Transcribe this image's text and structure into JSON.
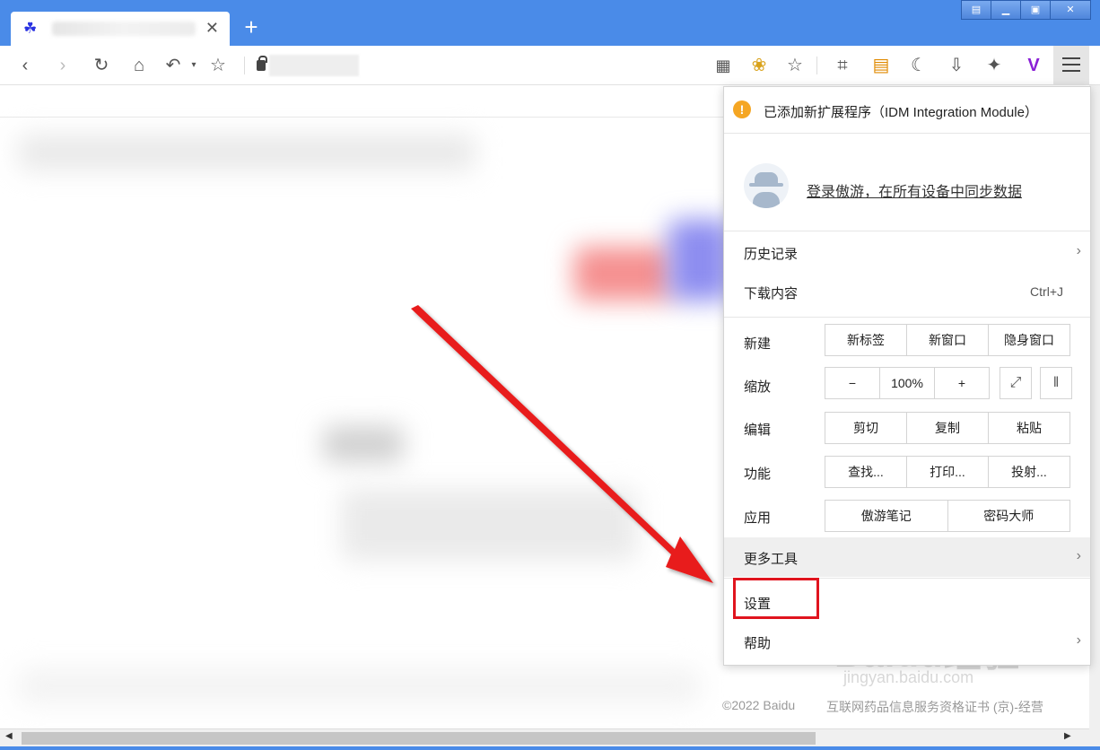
{
  "window": {
    "controls": [
      "restore-icon",
      "minimize-icon",
      "maximize-icon",
      "close-icon"
    ]
  },
  "tab": {
    "icon": "baidu-paw-icon",
    "close_label": "✕"
  },
  "toolbar": {
    "icons_left": [
      "back-icon",
      "forward-icon",
      "reload-icon",
      "home-icon",
      "undo-icon",
      "star-icon"
    ],
    "icons_right": [
      "qr-code-icon",
      "bee-icon",
      "star-icon",
      "crop-icon",
      "note-icon",
      "night-mode-icon",
      "download-icon",
      "extension-icon",
      "v-logo-icon",
      "menu-icon"
    ]
  },
  "menu": {
    "notice": "已添加新扩展程序（IDM Integration Module）",
    "login_link": "登录傲游，在所有设备中同步数据",
    "history": "历史记录",
    "downloads": "下载内容",
    "downloads_shortcut": "Ctrl+J",
    "new_label": "新建",
    "new_items": [
      "新标签",
      "新窗口",
      "隐身窗口"
    ],
    "zoom_label": "缩放",
    "zoom_minus": "−",
    "zoom_value": "100%",
    "zoom_plus": "+",
    "edit_label": "编辑",
    "edit_items": [
      "剪切",
      "复制",
      "粘贴"
    ],
    "func_label": "功能",
    "func_items": [
      "查找...",
      "打印...",
      "投射..."
    ],
    "apps_label": "应用",
    "apps_items": [
      "傲游笔记",
      "密码大师"
    ],
    "more_tools": "更多工具",
    "settings": "设置",
    "help": "帮助"
  },
  "page": {
    "footer_left": "©2022 Baidu",
    "footer_right": "互联网药品信息服务资格证书 (京)-经营",
    "watermark": "Baidu经验",
    "watermark_sub": "jingyan.baidu.com"
  },
  "colors": {
    "titlebar": "#4a8be8",
    "highlight": "#e0141e",
    "warning": "#f5a623"
  }
}
